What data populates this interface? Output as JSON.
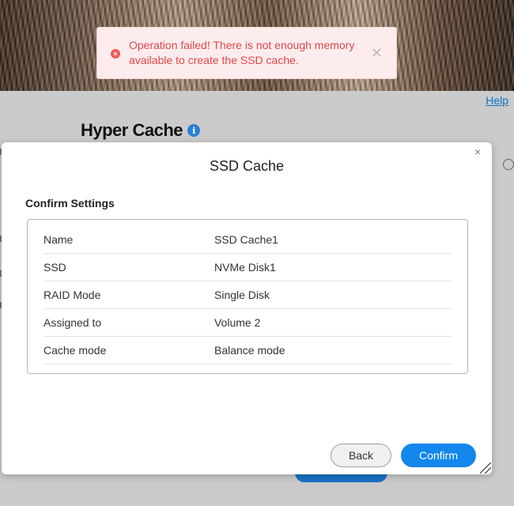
{
  "toast": {
    "icon": "error-icon",
    "message": "Operation failed! There is not enough memory available to create the SSD cache.",
    "close_glyph": "✕",
    "color": "#e0474b"
  },
  "background": {
    "help_link": "Help",
    "page_title": "Hyper Cache",
    "info_glyph": "i"
  },
  "dialog": {
    "title": "SSD Cache",
    "close_glyph": "×",
    "section_title": "Confirm Settings",
    "rows": [
      {
        "label": "Name",
        "value": "SSD Cache1"
      },
      {
        "label": "SSD",
        "value": "NVMe Disk1"
      },
      {
        "label": "RAID Mode",
        "value": "Single Disk"
      },
      {
        "label": "Assigned to",
        "value": "Volume 2"
      },
      {
        "label": "Cache mode",
        "value": "Balance mode"
      }
    ],
    "back_label": "Back",
    "confirm_label": "Confirm",
    "accent_color": "#1387ec"
  }
}
